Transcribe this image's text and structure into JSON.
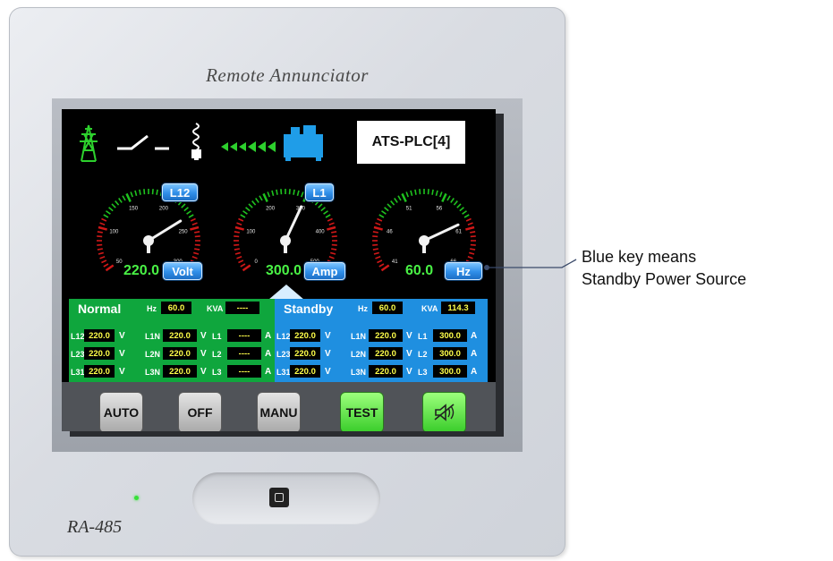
{
  "device": {
    "title": "Remote Annunciator",
    "model": "RA-485"
  },
  "screen": {
    "source_bar": {
      "ats_label": "ATS-PLC[4]",
      "icons": [
        "transmission-tower-icon",
        "switch-icon",
        "lamp-icon",
        "flow-arrows-icon",
        "generator-icon"
      ]
    },
    "gauges": [
      {
        "key": "L12",
        "value": "220.0",
        "unit": "Volt",
        "min": 0,
        "max": 300,
        "level": 220,
        "ticks": [
          "50",
          "100",
          "150",
          "200",
          "250",
          "300"
        ]
      },
      {
        "key": "L1",
        "value": "300.0",
        "unit": "Amp",
        "min": 0,
        "max": 500,
        "level": 300,
        "ticks": [
          "0",
          "100",
          "200",
          "300",
          "400",
          "500"
        ]
      },
      {
        "key": "",
        "value": "60.0",
        "unit": "Hz",
        "min": 41,
        "max": 66,
        "level": 60,
        "ticks": [
          "41",
          "46",
          "51",
          "56",
          "61",
          "66"
        ]
      }
    ],
    "normal": {
      "title": "Normal",
      "hz_label": "Hz",
      "hz": "60.0",
      "kva_label": "KVA",
      "kva": "----",
      "rows": [
        {
          "ll_label": "L12",
          "ll": "220.0",
          "ln_label": "L1N",
          "ln": "220.0",
          "l_label": "L1",
          "l": "----"
        },
        {
          "ll_label": "L23",
          "ll": "220.0",
          "ln_label": "L2N",
          "ln": "220.0",
          "l_label": "L2",
          "l": "----"
        },
        {
          "ll_label": "L31",
          "ll": "220.0",
          "ln_label": "L3N",
          "ln": "220.0",
          "l_label": "L3",
          "l": "----"
        }
      ]
    },
    "standby": {
      "title": "Standby",
      "hz_label": "Hz",
      "hz": "60.0",
      "kva_label": "KVA",
      "kva": "114.3",
      "rows": [
        {
          "ll_label": "L12",
          "ll": "220.0",
          "ln_label": "L1N",
          "ln": "220.0",
          "l_label": "L1",
          "l": "300.0"
        },
        {
          "ll_label": "L23",
          "ll": "220.0",
          "ln_label": "L2N",
          "ln": "220.0",
          "l_label": "L2",
          "l": "300.0"
        },
        {
          "ll_label": "L31",
          "ll": "220.0",
          "ln_label": "L3N",
          "ln": "220.0",
          "l_label": "L3",
          "l": "300.0"
        }
      ]
    },
    "units": {
      "volt": "V",
      "amp": "A"
    },
    "buttons": {
      "auto": "AUTO",
      "off": "OFF",
      "manu": "MANU",
      "test": "TEST",
      "mute_icon": "speaker-mute-icon"
    }
  },
  "annotation": {
    "line1": "Blue key means",
    "line2": "Standby Power Source"
  },
  "colors": {
    "normal_panel": "#0fa63d",
    "standby_panel": "#1f8fe0",
    "value_text": "#ffff4a",
    "gauge_value": "#49f245"
  }
}
